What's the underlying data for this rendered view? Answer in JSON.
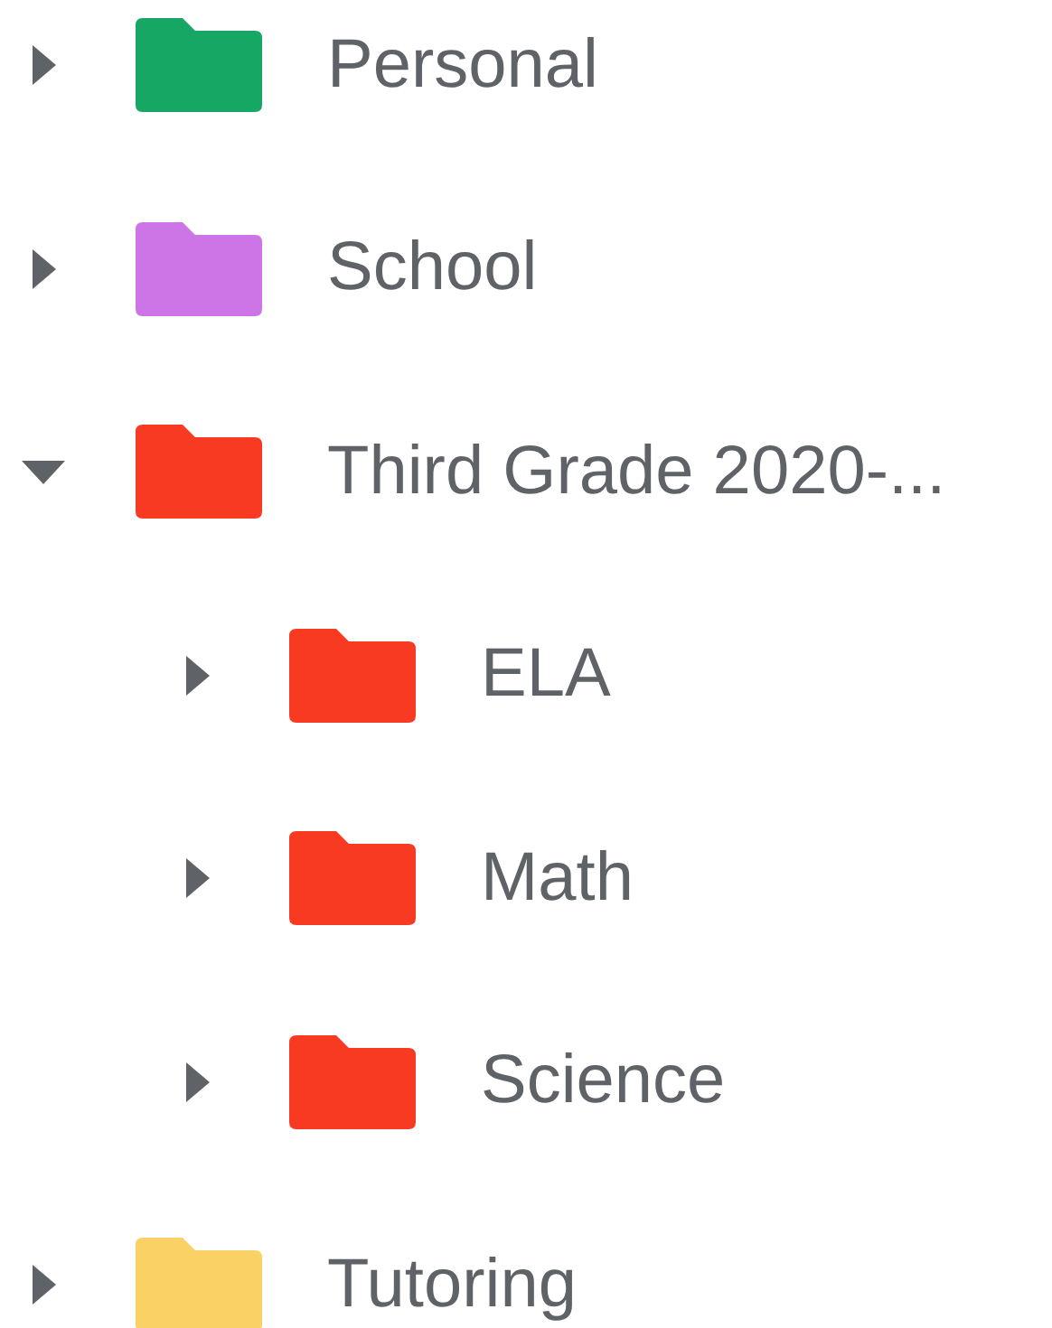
{
  "folders": [
    {
      "name": "Personal",
      "color": "#16a765",
      "expanded": false
    },
    {
      "name": "School",
      "color": "#cd74e6",
      "expanded": false
    },
    {
      "name": "Third Grade 2020-...",
      "color": "#f83a22",
      "expanded": true,
      "children": [
        {
          "name": "ELA",
          "color": "#f83a22",
          "expanded": false
        },
        {
          "name": "Math",
          "color": "#f83a22",
          "expanded": false
        },
        {
          "name": "Science",
          "color": "#f83a22",
          "expanded": false
        }
      ]
    },
    {
      "name": "Tutoring",
      "color": "#fad165",
      "expanded": false
    }
  ]
}
